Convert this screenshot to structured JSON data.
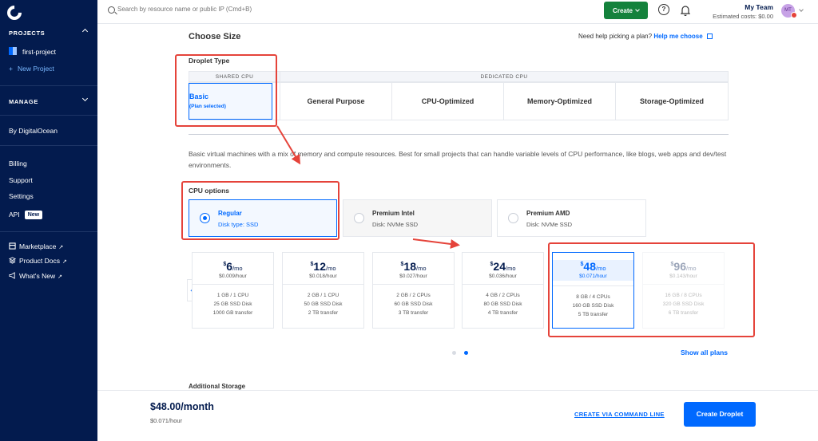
{
  "sidebar": {
    "projects_heading": "PROJECTS",
    "project_name": "first-project",
    "new_project": "New Project",
    "manage_heading": "MANAGE",
    "by_digitalocean": "By DigitalOcean",
    "billing": "Billing",
    "support": "Support",
    "settings": "Settings",
    "api": "API",
    "api_badge": "New",
    "marketplace": "Marketplace",
    "product_docs": "Product Docs",
    "whats_new": "What's New"
  },
  "topbar": {
    "search_placeholder": "Search by resource name or public IP (Cmd+B)",
    "create_label": "Create",
    "help_icon": "?",
    "team_name": "My Team",
    "estimated_costs": "Estimated costs: $0.00",
    "avatar_initials": "MT"
  },
  "main": {
    "title": "Choose Size",
    "help_text": "Need help picking a plan?",
    "help_link": "Help me choose",
    "droplet_type_label": "Droplet Type",
    "shared_cpu_header": "SHARED CPU",
    "dedicated_cpu_header": "DEDICATED CPU",
    "types": {
      "basic": "Basic",
      "basic_sub": "(Plan selected)",
      "general_purpose": "General Purpose",
      "cpu_optimized": "CPU-Optimized",
      "memory_optimized": "Memory-Optimized",
      "storage_optimized": "Storage-Optimized"
    },
    "description": "Basic virtual machines with a mix of memory and compute resources. Best for small projects that can handle variable levels of CPU performance, like blogs, web apps and dev/test environments.",
    "cpu_options_label": "CPU options",
    "cpu_options": [
      {
        "title": "Regular",
        "sub": "Disk type: SSD"
      },
      {
        "title": "Premium Intel",
        "sub": "Disk: NVMe SSD"
      },
      {
        "title": "Premium AMD",
        "sub": "Disk: NVMe SSD"
      }
    ],
    "plans": [
      {
        "currency": "$",
        "price": "6",
        "per": "/mo",
        "hourly": "$0.009/hour",
        "mem_cpu": "1 GB / 1 CPU",
        "disk": "25 GB SSD Disk",
        "transfer": "1000 GB transfer"
      },
      {
        "currency": "$",
        "price": "12",
        "per": "/mo",
        "hourly": "$0.018/hour",
        "mem_cpu": "2 GB / 1 CPU",
        "disk": "50 GB SSD Disk",
        "transfer": "2 TB transfer"
      },
      {
        "currency": "$",
        "price": "18",
        "per": "/mo",
        "hourly": "$0.027/hour",
        "mem_cpu": "2 GB / 2 CPUs",
        "disk": "60 GB SSD Disk",
        "transfer": "3 TB transfer"
      },
      {
        "currency": "$",
        "price": "24",
        "per": "/mo",
        "hourly": "$0.036/hour",
        "mem_cpu": "4 GB / 2 CPUs",
        "disk": "80 GB SSD Disk",
        "transfer": "4 TB transfer"
      },
      {
        "currency": "$",
        "price": "48",
        "per": "/mo",
        "hourly": "$0.071/hour",
        "mem_cpu": "8 GB / 4 CPUs",
        "disk": "160 GB SSD Disk",
        "transfer": "5 TB transfer"
      },
      {
        "currency": "$",
        "price": "96",
        "per": "/mo",
        "hourly": "$0.143/hour",
        "mem_cpu": "16 GB / 8 CPUs",
        "disk": "320 GB SSD Disk",
        "transfer": "6 TB transfer"
      }
    ],
    "prev_arrow": "←",
    "show_all_plans": "Show all plans",
    "additional_storage": "Additional Storage"
  },
  "footer": {
    "monthly_price": "$48.00/month",
    "hourly_price": "$0.071/hour",
    "cli_link": "CREATE VIA COMMAND LINE",
    "create_droplet": "Create Droplet"
  },
  "colors": {
    "sidebar_bg": "#031b4e",
    "accent": "#0069ff",
    "create_green": "#14823c",
    "annotation_red": "#e5433a"
  }
}
